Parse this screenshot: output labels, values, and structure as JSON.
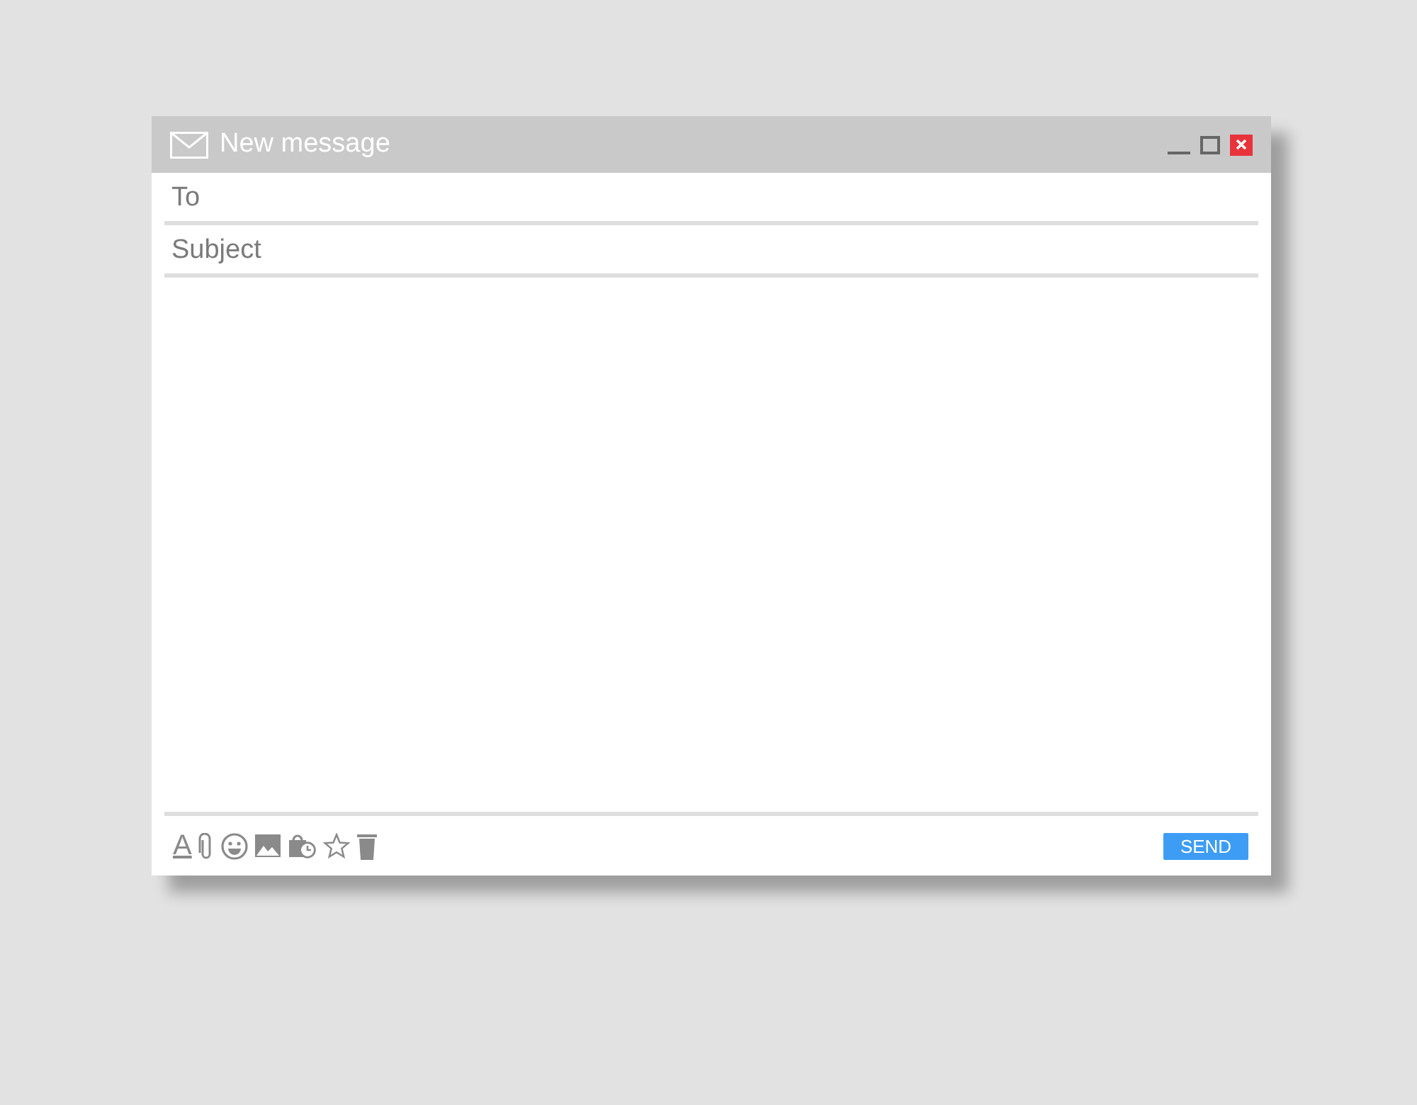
{
  "window": {
    "title": "New message"
  },
  "fields": [
    {
      "placeholder": "To"
    },
    {
      "placeholder": "Subject"
    }
  ],
  "toolbar": {
    "format_label": "A",
    "send": "SEND"
  }
}
